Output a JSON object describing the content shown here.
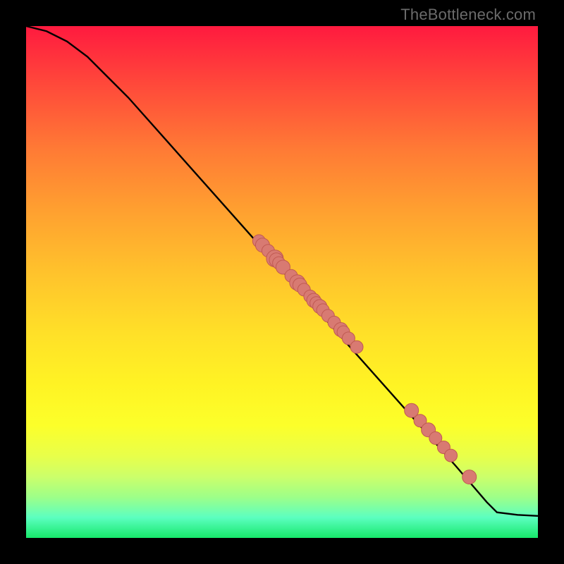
{
  "watermark": "TheBottleneck.com",
  "colors": {
    "background": "#000000",
    "curve": "#000000",
    "marker_fill": "#d87a72",
    "marker_stroke": "#c05a52"
  },
  "chart_data": {
    "type": "line",
    "title": "",
    "xlabel": "",
    "ylabel": "",
    "xlim": [
      0,
      100
    ],
    "ylim": [
      0,
      100
    ],
    "grid": false,
    "curve": {
      "x": [
        0,
        4,
        8,
        12,
        16,
        20,
        28,
        36,
        44,
        52,
        60,
        68,
        76,
        84,
        90,
        92,
        96,
        100
      ],
      "y": [
        100,
        99,
        97,
        94,
        90,
        86,
        77,
        68,
        59,
        50,
        41,
        32,
        23,
        14,
        7,
        5,
        4.5,
        4.3
      ]
    },
    "markers": {
      "x": [
        45.5,
        46.2,
        47.3,
        48.6,
        48.9,
        49.4,
        50.2,
        51.8,
        53.0,
        53.5,
        54.3,
        55.5,
        56.2,
        56.7,
        57.4,
        58.0,
        59.0,
        60.2,
        61.5,
        62.0,
        63.0,
        64.6,
        75.3,
        77.0,
        78.6,
        80.0,
        81.6,
        83.0,
        86.6
      ],
      "y": [
        58.0,
        57.2,
        56.1,
        54.6,
        54.3,
        53.7,
        52.9,
        51.2,
        49.9,
        49.4,
        48.5,
        47.2,
        46.4,
        45.9,
        45.2,
        44.5,
        43.4,
        42.1,
        40.7,
        40.2,
        39.0,
        37.3,
        24.9,
        22.9,
        21.1,
        19.5,
        17.7,
        16.1,
        11.9
      ],
      "r": [
        9,
        10,
        9,
        12,
        10,
        9,
        10,
        9,
        11,
        10,
        9,
        9,
        10,
        9,
        10,
        9,
        9,
        9,
        10,
        9,
        9,
        9,
        10,
        9,
        10,
        9,
        9,
        9,
        10
      ]
    }
  }
}
